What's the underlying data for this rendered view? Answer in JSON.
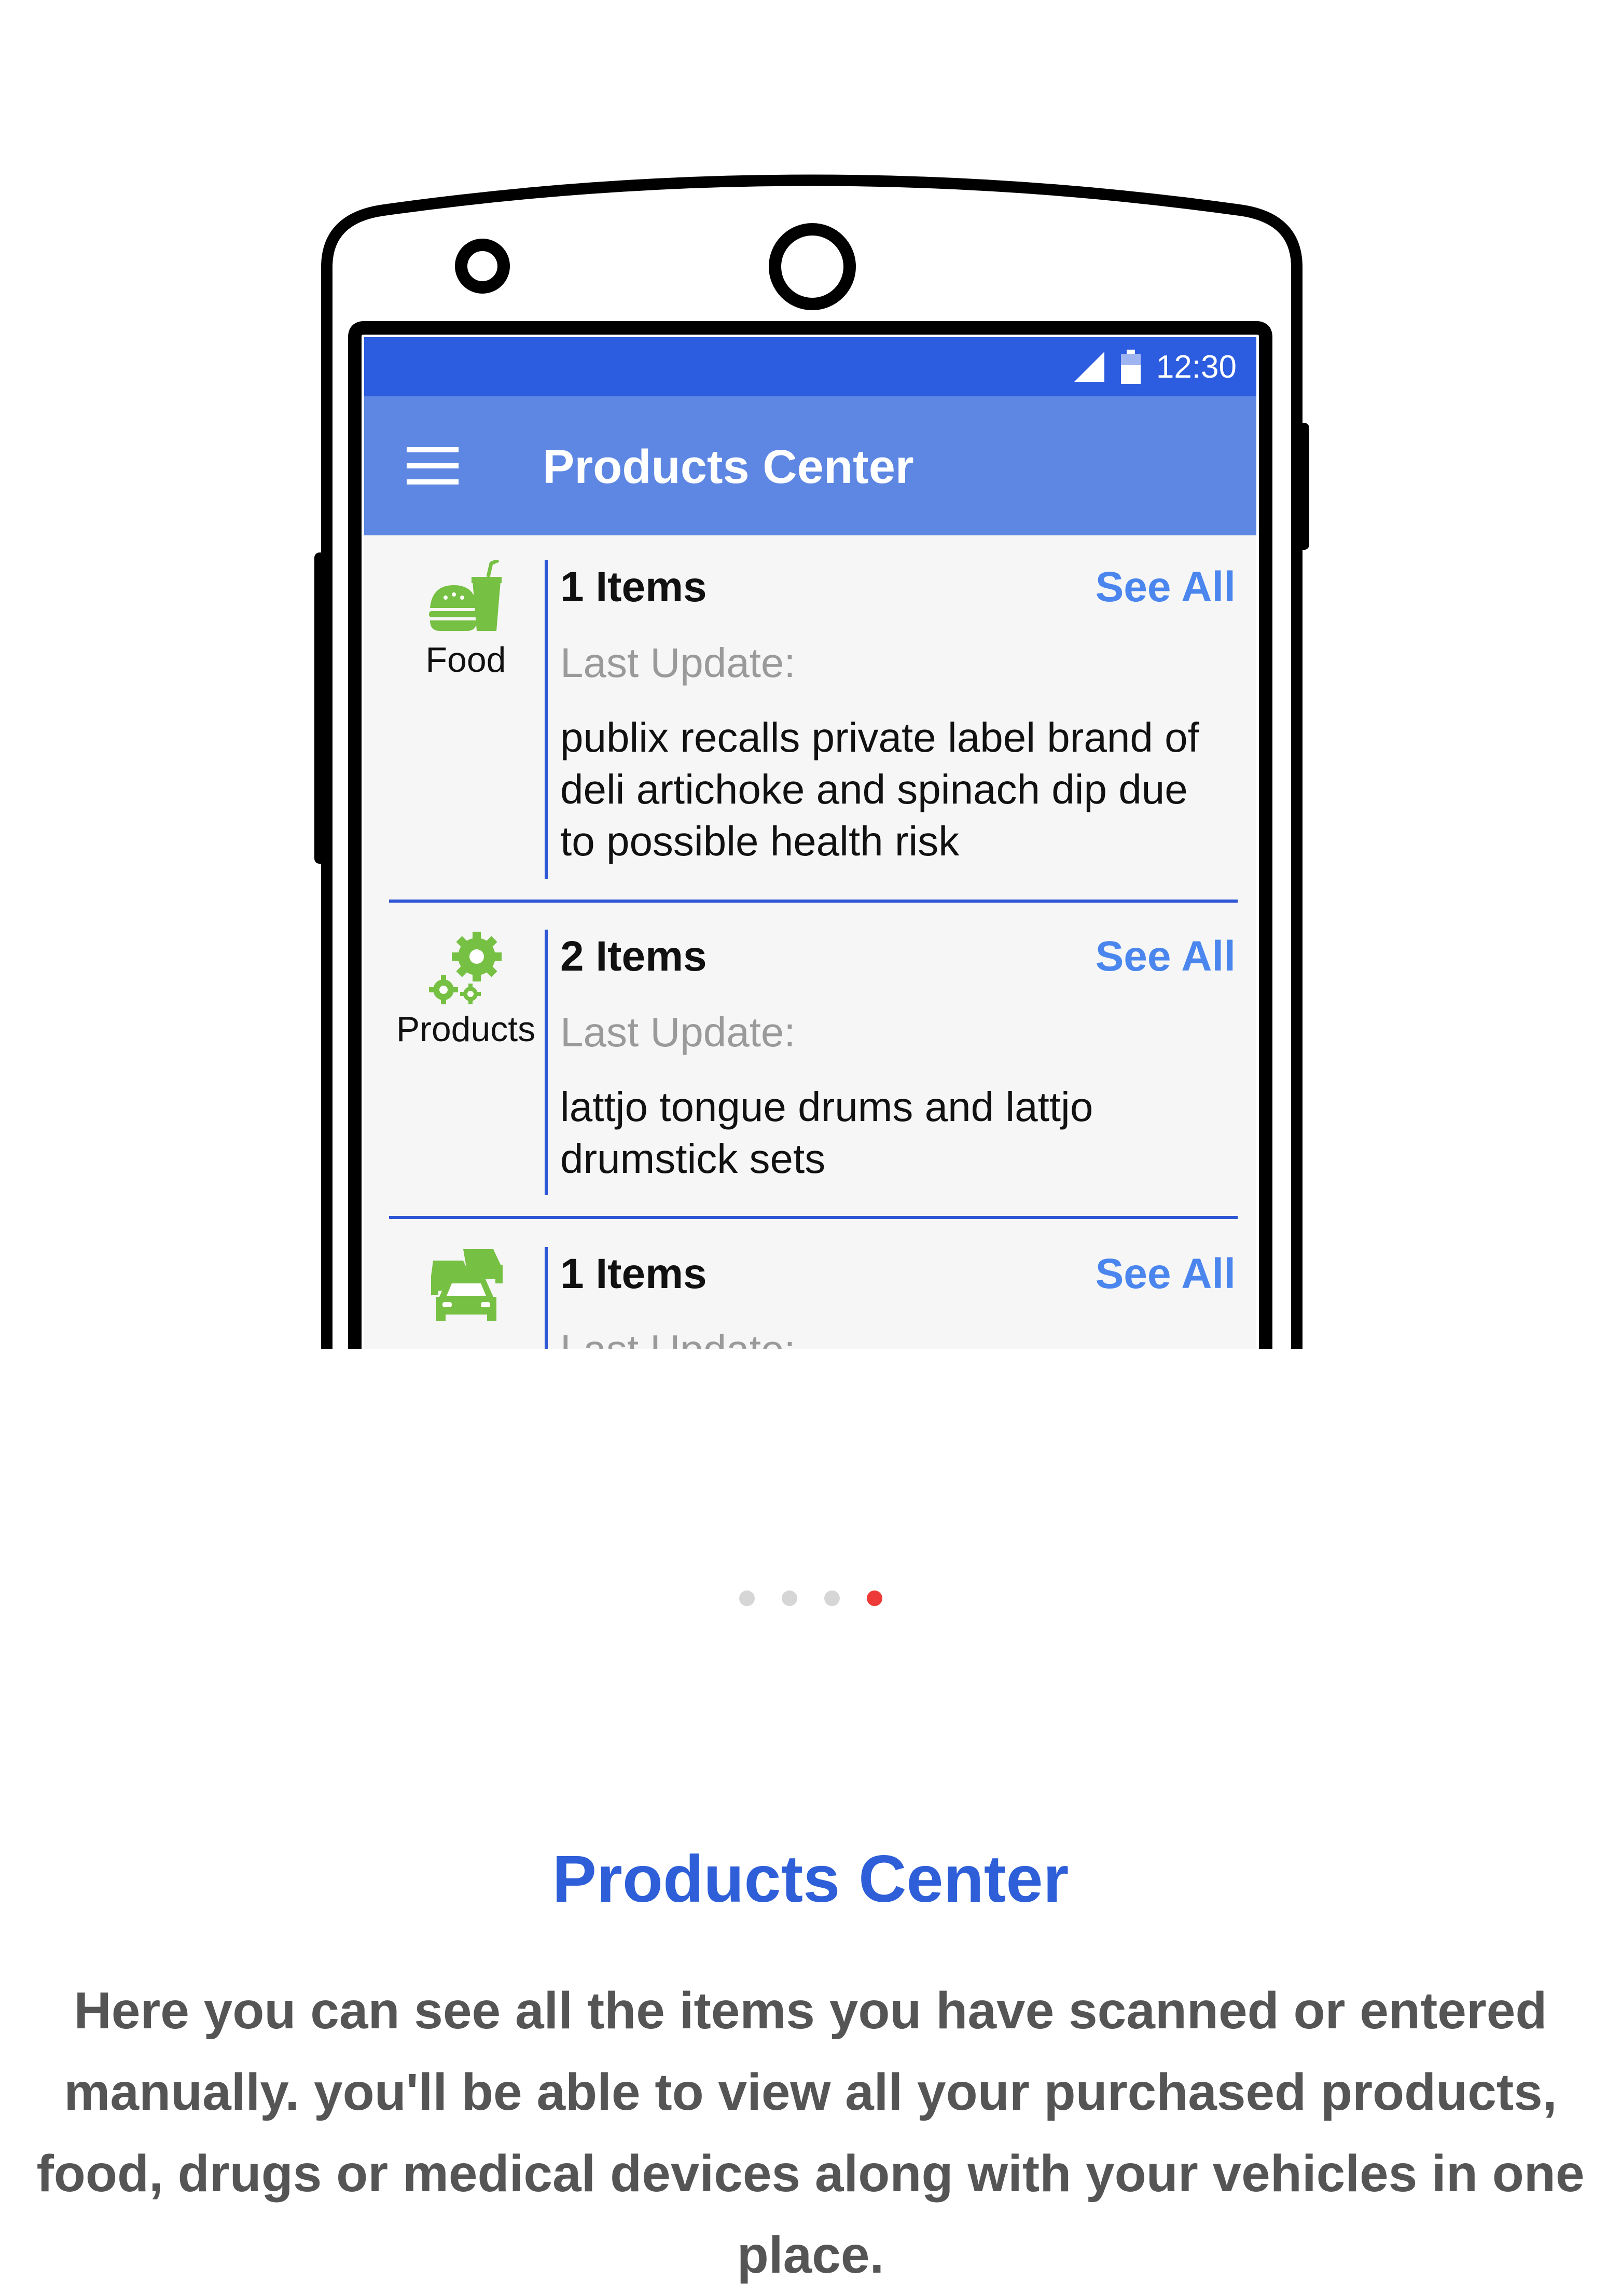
{
  "status_bar": {
    "time": "12:30",
    "icons": [
      "signal-icon",
      "battery-icon"
    ]
  },
  "app_bar": {
    "menu_icon": "hamburger-menu-icon",
    "title": "Products Center"
  },
  "cards": [
    {
      "category": "Food",
      "icon": "food-icon",
      "items": "1 Items",
      "see_all": "See All",
      "last_update_label": "Last Update:",
      "description": "publix recalls private label brand of deli artichoke and spinach dip due to possible health risk"
    },
    {
      "category": "Products",
      "icon": "gears-icon",
      "items": "2 Items",
      "see_all": "See All",
      "last_update_label": "Last Update:",
      "description": "lattjo tongue drums and lattjo drumstick sets"
    },
    {
      "category": "",
      "icon": "vehicles-icon",
      "items": "1 Items",
      "see_all": "See All",
      "last_update_label": "Last Update:",
      "description": ""
    }
  ],
  "pagination": {
    "total": 4,
    "active_index": 3
  },
  "colors": {
    "status_bar": "#2c5ce0",
    "app_bar": "#5d87e2",
    "accent_link": "#4a86ee",
    "divider": "#2e57d6",
    "icon_green": "#76c043",
    "active_dot": "#ef3b37",
    "caption_title": "#2e5fd8",
    "caption_body": "#555555"
  },
  "caption": {
    "title": "Products Center",
    "body": "Here you can see all the items you have scanned or entered manually. you'll be able to view all your purchased products, food, drugs or medical devices along with your vehicles in one place."
  }
}
